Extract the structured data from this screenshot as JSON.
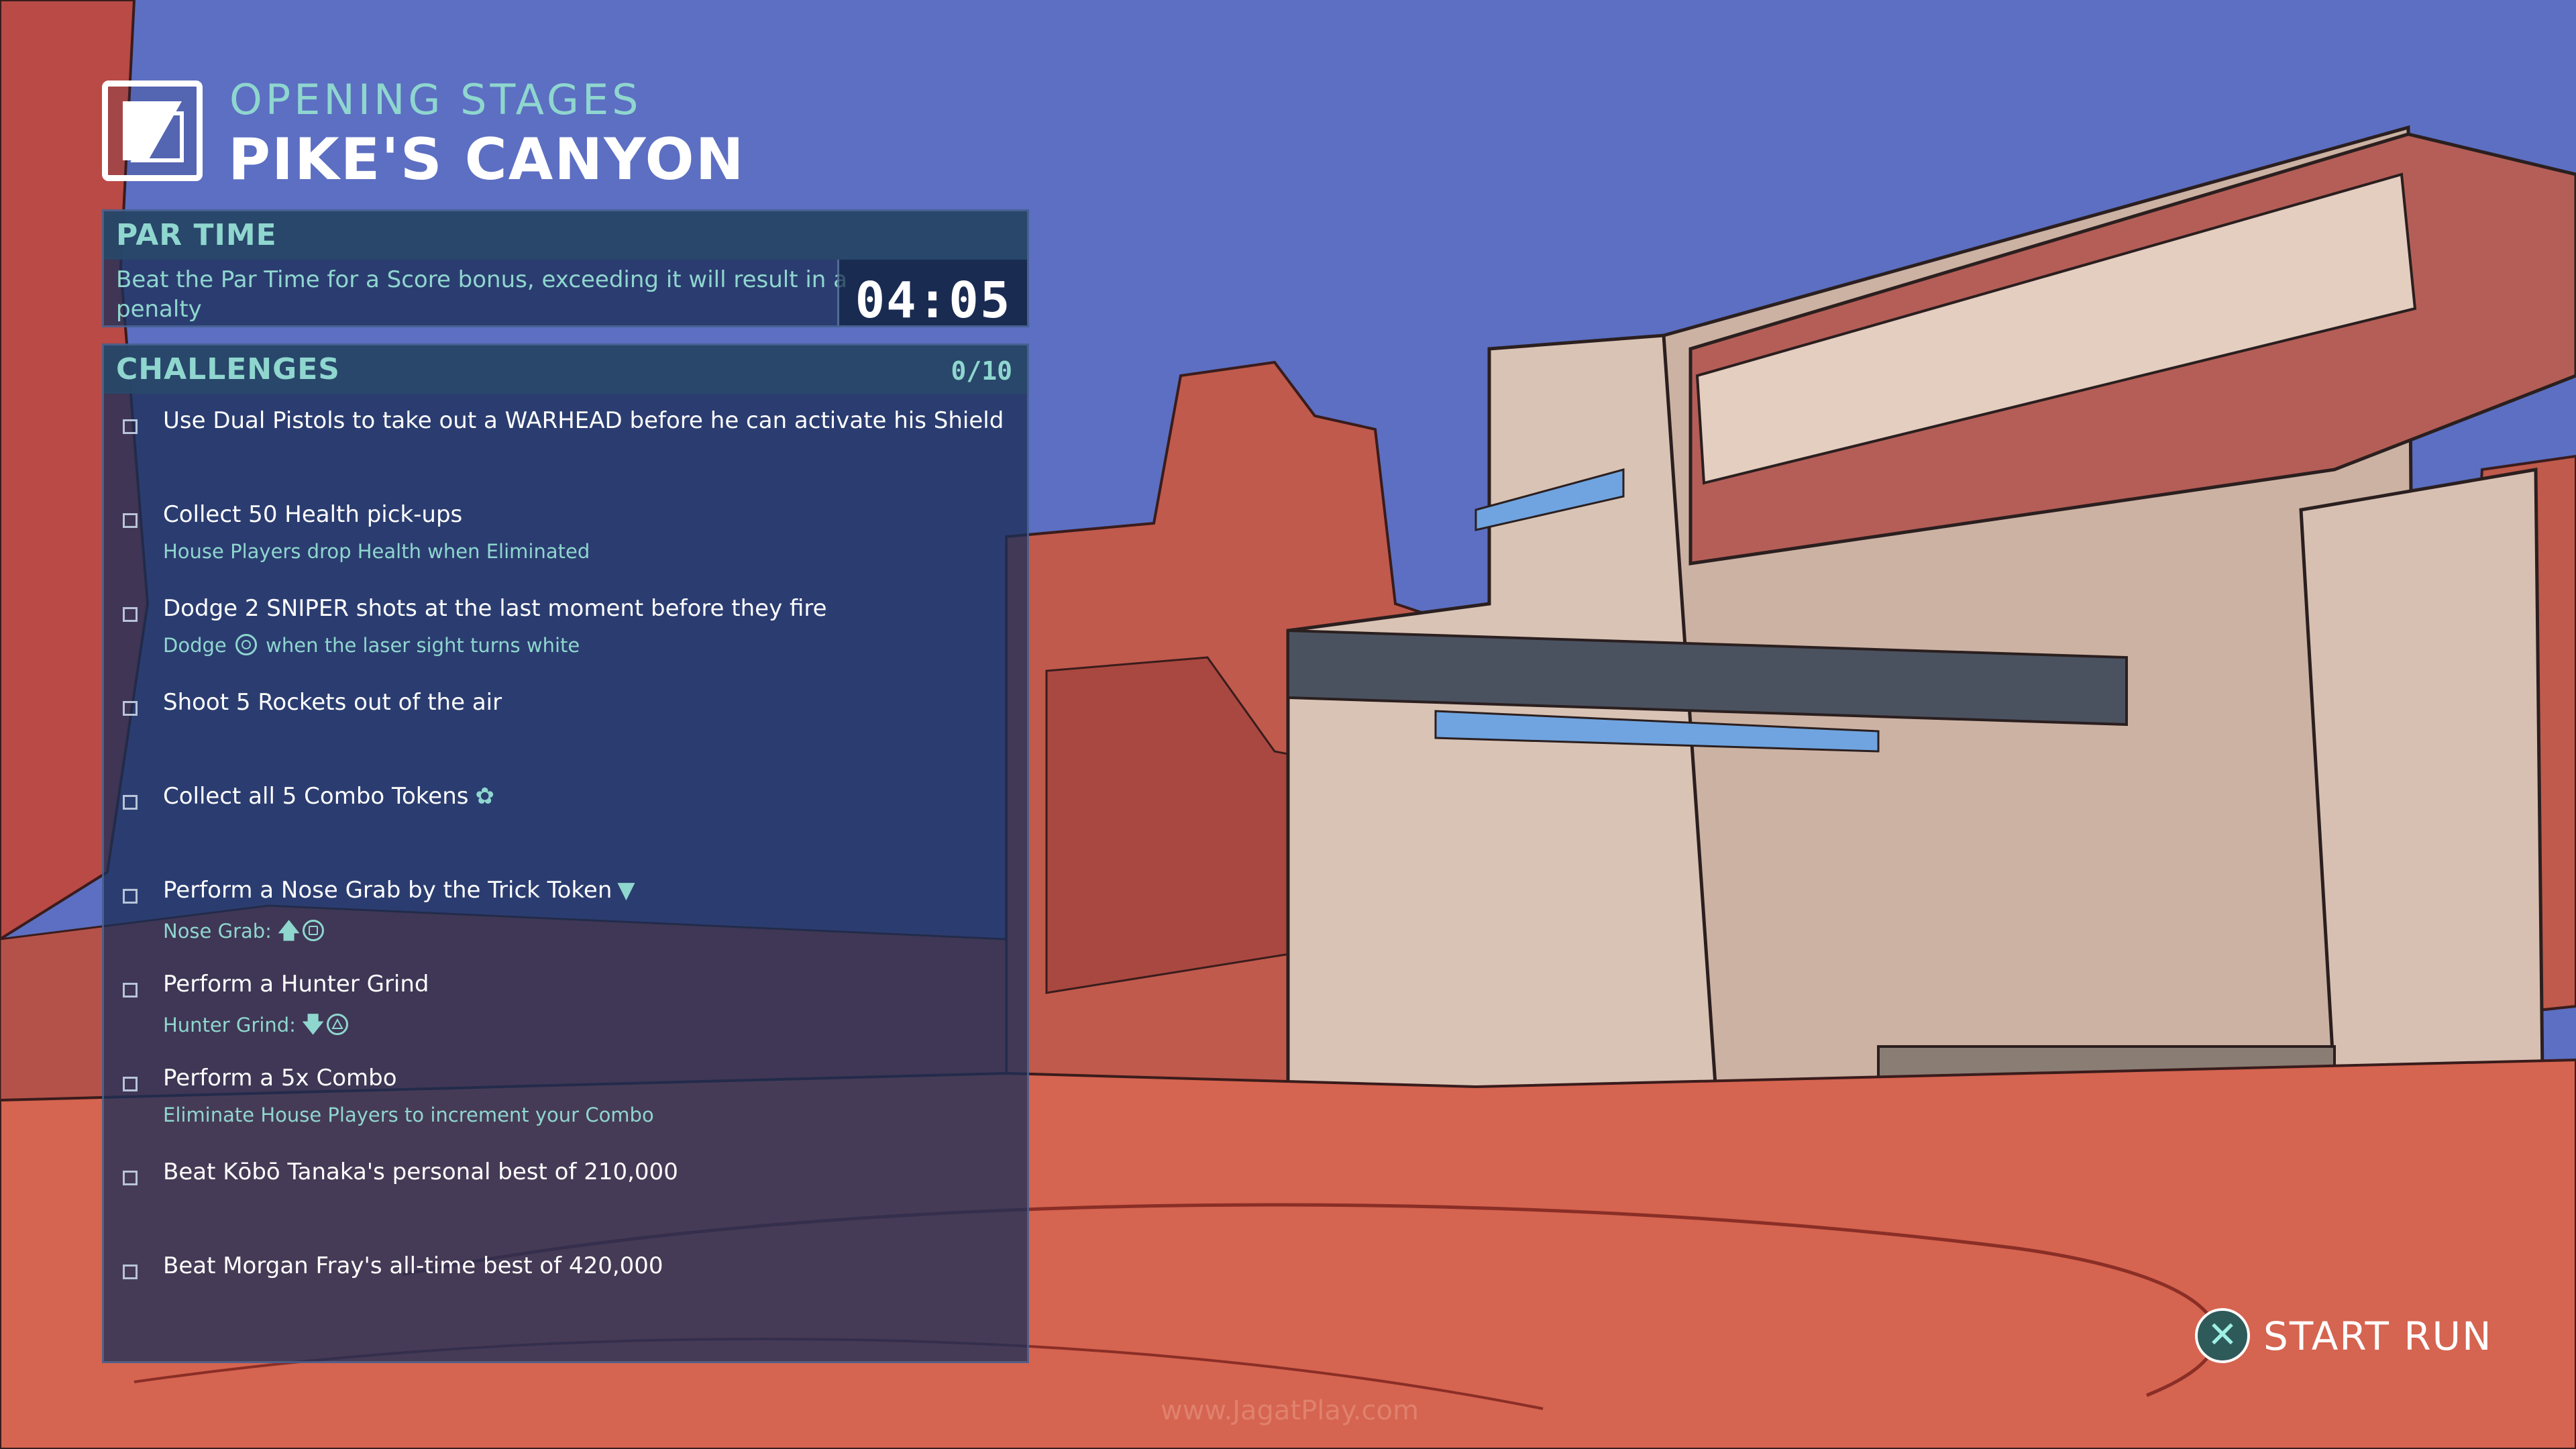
{
  "stage": {
    "subtitle": "OPENING STAGES",
    "title": "PIKE'S CANYON"
  },
  "par_time": {
    "header": "PAR TIME",
    "description": "Beat the Par Time for a Score bonus, exceeding it will result in a penalty",
    "value": "04:05"
  },
  "challenges": {
    "header": "CHALLENGES",
    "count": "0/10",
    "items": [
      {
        "title": "Use Dual Pistols to take out a WARHEAD before he can activate his Shield",
        "hint": ""
      },
      {
        "title": "Collect 50 Health pick-ups",
        "hint": "House Players drop Health when Eliminated"
      },
      {
        "title": "Dodge 2 SNIPER shots at the last moment before they fire",
        "hint_pre": "Dodge",
        "hint_post": "when the laser sight turns white",
        "icon": "circle-button-icon"
      },
      {
        "title": "Shoot 5 Rockets out of the air",
        "hint": ""
      },
      {
        "title": "Collect all 5 Combo Tokens",
        "icon": "combo-token-icon"
      },
      {
        "title": "Perform a Nose Grab by the Trick Token",
        "hint": "Nose Grab:",
        "icon": "trick-token-icon",
        "hint_icons": [
          "up-arrow-icon",
          "square-button-icon"
        ]
      },
      {
        "title": "Perform a Hunter Grind",
        "hint": "Hunter Grind:",
        "hint_icons": [
          "down-arrow-icon",
          "triangle-button-icon"
        ]
      },
      {
        "title": "Perform a 5x Combo",
        "hint": "Eliminate House Players to increment your Combo"
      },
      {
        "title": "Beat Kōbō Tanaka's personal best of 210,000",
        "hint": ""
      },
      {
        "title": "Beat Morgan Fray's all-time best of 420,000",
        "hint": ""
      }
    ]
  },
  "start_run": {
    "label": "START RUN",
    "button_icon": "cross-button-icon"
  },
  "watermark": "www.JagatPlay.com",
  "colors": {
    "sky": "#5c6fc2",
    "canyon": "#c4574a",
    "ground": "#d56450",
    "accent": "#8fd6cf",
    "panel": "#1e3058"
  }
}
